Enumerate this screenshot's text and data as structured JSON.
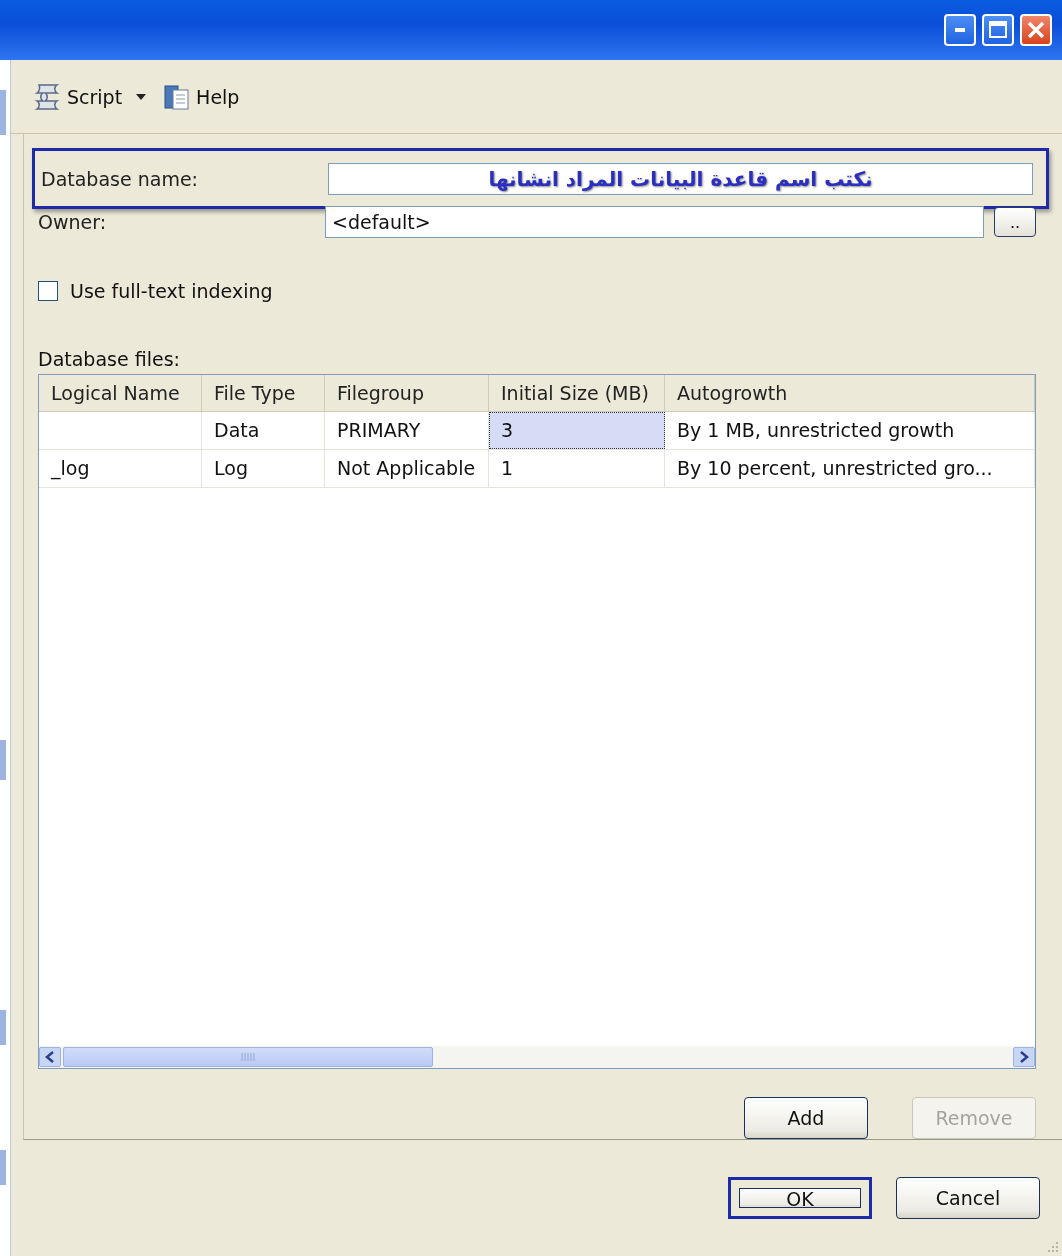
{
  "toolbar": [
    {
      "kind": "script",
      "label": "Script"
    },
    {
      "kind": "dropdown"
    },
    {
      "kind": "help",
      "label": "Help"
    }
  ],
  "database_name": {
    "label": "Database name:",
    "value": "نكتب اسم قاعدة البيانات المراد انشانها",
    "highlighted": true
  },
  "owner": {
    "label": "Owner:",
    "value": "<default>",
    "browse_label": ".."
  },
  "full_text_indexing": {
    "label": "Use full-text indexing",
    "checked": false
  },
  "database_files": {
    "label": "Database files:",
    "columns": [
      "Logical Name",
      "File Type",
      "Filegroup",
      "Initial Size (MB)",
      "Autogrowth"
    ],
    "rows": [
      {
        "cells": [
          {
            "selected": false
          },
          {
            "text": "Data",
            "selected": false
          },
          {
            "text": "PRIMARY",
            "selected": false
          },
          {
            "text": "3",
            "selected": true
          },
          {
            "text": "By 1 MB, unrestricted growth",
            "selected": false
          }
        ]
      },
      {
        "cells": [
          {
            "text": "_log",
            "selected": false
          },
          {
            "text": "Log",
            "selected": false
          },
          {
            "text": "Not Applicable",
            "selected": false
          },
          {
            "text": "1",
            "selected": false
          },
          {
            "text": "By 10 percent, unrestricted gro...",
            "selected": false
          }
        ]
      }
    ]
  },
  "file_buttons": [
    {
      "label": "Add",
      "disabled": false
    },
    {
      "label": "Remove",
      "disabled": true
    }
  ],
  "dialog_buttons": [
    {
      "label": "OK",
      "highlighted": true
    },
    {
      "label": "Cancel",
      "highlighted": false
    }
  ]
}
